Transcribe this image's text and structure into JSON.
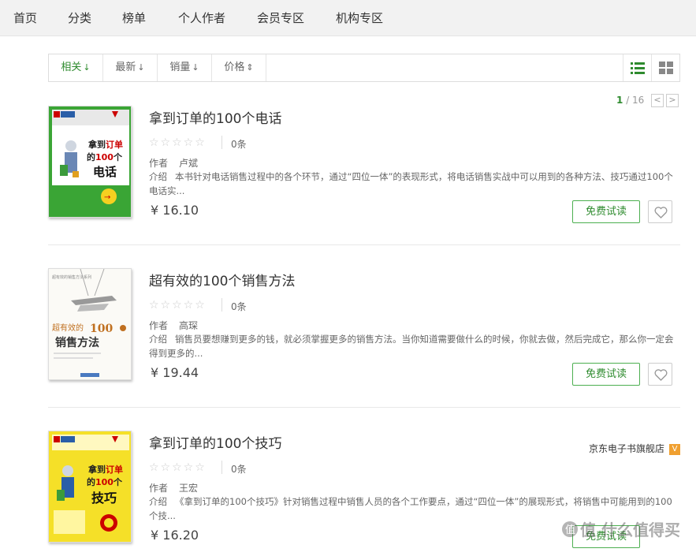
{
  "nav": {
    "items": [
      "首页",
      "分类",
      "榜单",
      "个人作者",
      "会员专区",
      "机构专区"
    ]
  },
  "sort": {
    "options": [
      "相关",
      "最新",
      "销量",
      "价格"
    ],
    "active": "相关"
  },
  "pager": {
    "current": "1",
    "total": "/ 16",
    "prev": "<",
    "next": ">"
  },
  "labels": {
    "author": "作者",
    "intro": "介绍",
    "trial": "免费试读"
  },
  "books": [
    {
      "title": "拿到订单的100个电话",
      "stars": "☆☆☆☆☆",
      "count": "0条",
      "author": "卢斌",
      "intro": "本书针对电话销售过程中的各个环节，通过“四位一体”的表现形式，将电话销售实战中可以用到的各种方法、技巧通过100个电话实...",
      "price": "¥ 16.10",
      "cover_text": [
        "拿到订单",
        "的100个",
        "电话"
      ]
    },
    {
      "title": "超有效的100个销售方法",
      "stars": "☆☆☆☆☆",
      "count": "0条",
      "author": "高琛",
      "intro": "销售员要想赚到更多的钱，就必须掌握更多的销售方法。当你知道需要做什么的时候，你就去做，然后完成它，那么你一定会得到更多的...",
      "price": "¥ 19.44",
      "cover_text": [
        "超有效的100个",
        "销售方法"
      ]
    },
    {
      "title": "拿到订单的100个技巧",
      "stars": "☆☆☆☆☆",
      "count": "0条",
      "author": "王宏",
      "intro": "《拿到订单的100个技巧》针对销售过程中销售人员的各个工作要点，通过“四位一体”的展现形式，将销售中可能用到的100个技...",
      "price": "¥ 16.20",
      "shop": "京东电子书旗舰店",
      "shop_badge": "V",
      "cover_text": [
        "拿到订单",
        "的100个",
        "技巧"
      ]
    }
  ],
  "watermark": "值 什么值得买",
  "colors": {
    "accent": "#2e8b2e",
    "nav_bg": "#f2f2f2",
    "cover1_bg": "#3aa535",
    "cover3_bg": "#f5e028"
  }
}
